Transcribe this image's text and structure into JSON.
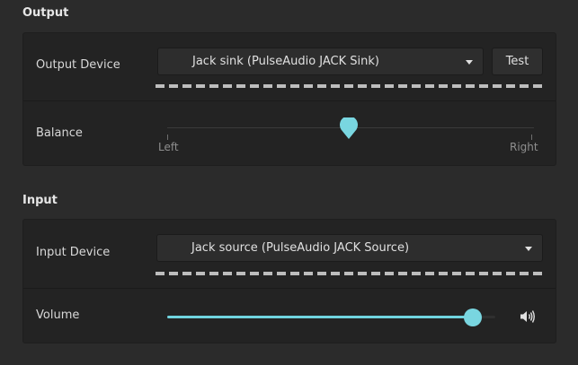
{
  "output": {
    "section_title": "Output",
    "device_label": "Output Device",
    "device_value": "Jack sink (PulseAudio JACK Sink)",
    "test_button": "Test",
    "balance_label": "Balance",
    "balance_left": "Left",
    "balance_right": "Right",
    "balance_value": 0.5
  },
  "input": {
    "section_title": "Input",
    "device_label": "Input Device",
    "device_value": "Jack source (PulseAudio JACK Source)",
    "volume_label": "Volume",
    "volume_value": 1.0
  },
  "colors": {
    "accent": "#79d6e0",
    "background": "#2b2b2b",
    "card": "#232323"
  },
  "icons": [
    "chevron-down-icon",
    "speaker-volume-icon"
  ]
}
